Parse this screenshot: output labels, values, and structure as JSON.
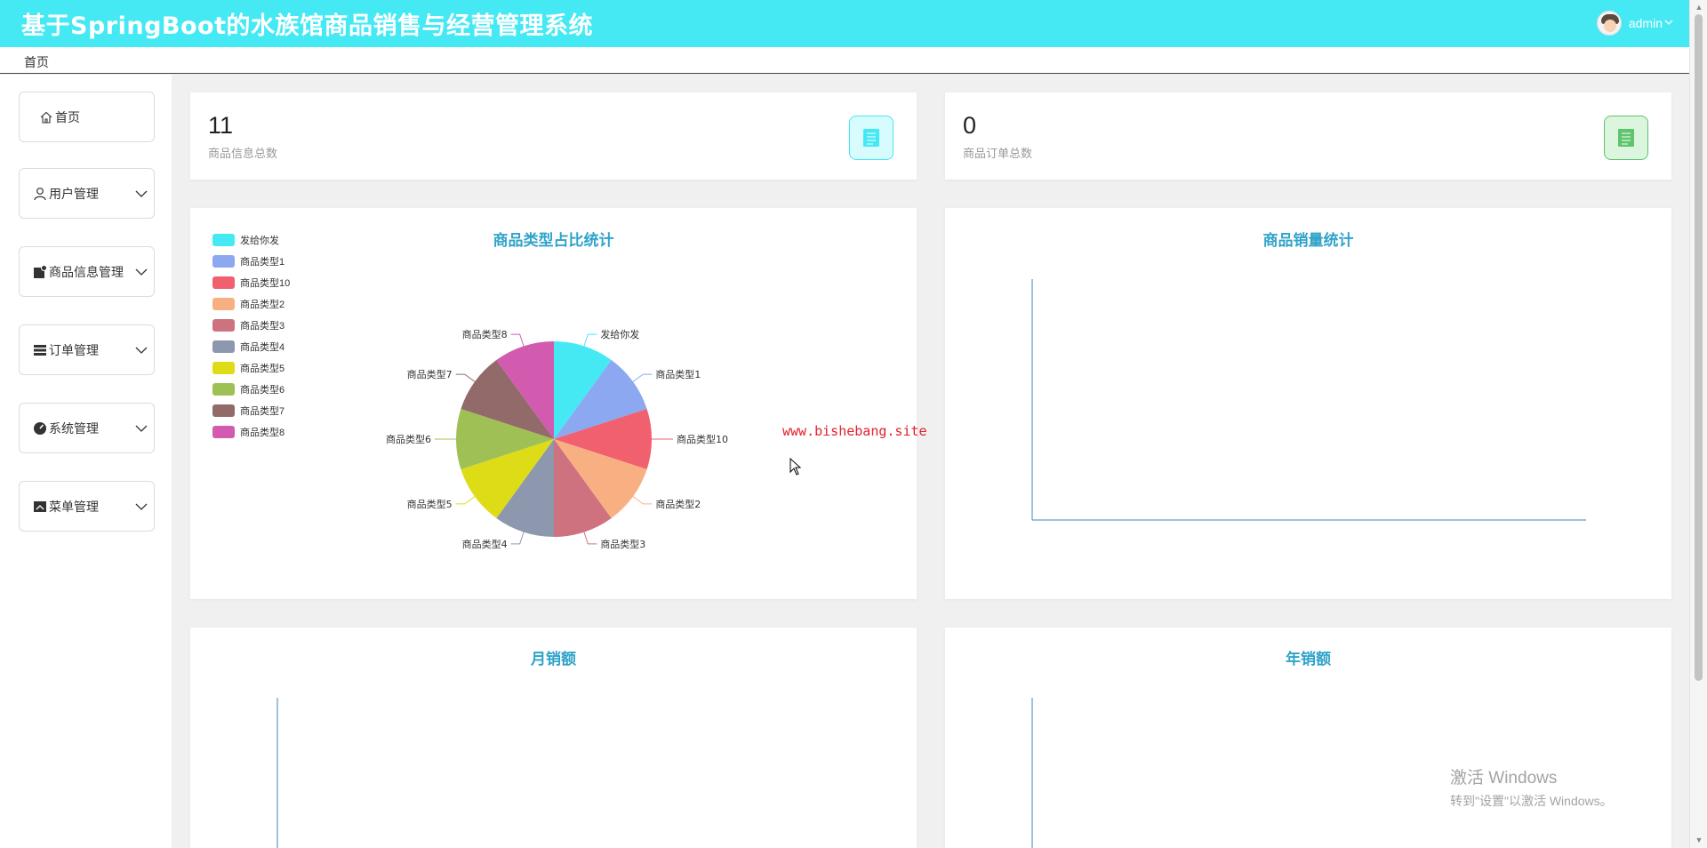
{
  "header": {
    "title": "基于SpringBoot的水族馆商品销售与经营管理系统",
    "user_name": "admin",
    "bg_color": "#45e9f4"
  },
  "breadcrumb": {
    "text": "首页"
  },
  "sidebar": {
    "items": [
      {
        "label": "首页",
        "icon": "home-icon",
        "expandable": false
      },
      {
        "label": "用户管理",
        "icon": "user-icon",
        "expandable": true
      },
      {
        "label": "商品信息管理",
        "icon": "goods-icon",
        "expandable": true
      },
      {
        "label": "订单管理",
        "icon": "order-list-icon",
        "expandable": true
      },
      {
        "label": "系统管理",
        "icon": "system-icon",
        "expandable": true
      },
      {
        "label": "菜单管理",
        "icon": "menu-icon",
        "expandable": true
      }
    ]
  },
  "stats": [
    {
      "value": "11",
      "label": "商品信息总数",
      "icon": "document-icon",
      "icon_color": "#45e9f4"
    },
    {
      "value": "0",
      "label": "商品订单总数",
      "icon": "document-icon",
      "icon_color": "#5ec46d"
    }
  ],
  "charts": {
    "pie_title": "商品类型占比统计",
    "sales_title": "商品销量统计",
    "monthly_title": "月销额",
    "yearly_title": "年销额",
    "title_color": "#2fa3c9"
  },
  "chart_data": [
    {
      "type": "pie",
      "title": "商品类型占比统计",
      "legend_position": "top-left",
      "slices": [
        {
          "name": "发给你发",
          "value": 1,
          "color": "#45e9f4"
        },
        {
          "name": "商品类型1",
          "value": 1,
          "color": "#8ca8f0"
        },
        {
          "name": "商品类型10",
          "value": 1,
          "color": "#f0606f"
        },
        {
          "name": "商品类型2",
          "value": 1,
          "color": "#f8b083"
        },
        {
          "name": "商品类型3",
          "value": 1,
          "color": "#cf7280"
        },
        {
          "name": "商品类型4",
          "value": 1,
          "color": "#8d97ad"
        },
        {
          "name": "商品类型5",
          "value": 1,
          "color": "#dedc17"
        },
        {
          "name": "商品类型6",
          "value": 1,
          "color": "#9fc055"
        },
        {
          "name": "商品类型7",
          "value": 1,
          "color": "#926a6a"
        },
        {
          "name": "商品类型8",
          "value": 1,
          "color": "#d25bb0"
        }
      ]
    },
    {
      "type": "bar",
      "title": "商品销量统计",
      "categories": [],
      "values": []
    },
    {
      "type": "bar",
      "title": "月销额",
      "categories": [],
      "values": []
    },
    {
      "type": "bar",
      "title": "年销额",
      "categories": [],
      "values": []
    }
  ],
  "overlay": {
    "watermark": "www.bishebang.site",
    "activation_line1": "激活 Windows",
    "activation_line2": "转到\"设置\"以激活 Windows。"
  }
}
